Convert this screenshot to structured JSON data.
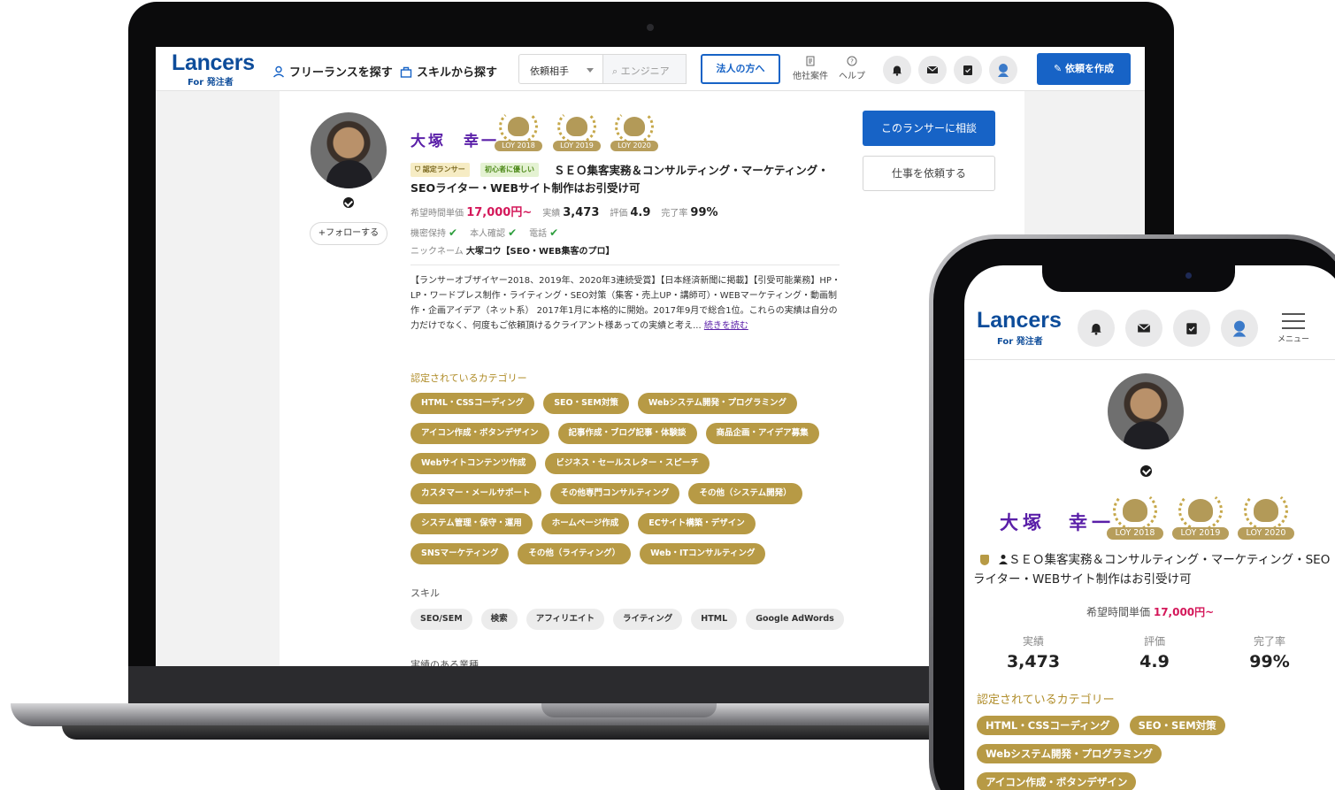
{
  "laptop": {
    "header": {
      "logo": "Lancers",
      "logo_sub": "For 発注者",
      "nav_find": "フリーランスを探す",
      "nav_skill": "スキルから探す",
      "dropdown_value": "依頼相手",
      "search_placeholder": "エンジニア",
      "corp_button": "法人の方へ",
      "link_other": "他社案件",
      "link_help": "ヘルプ",
      "create_button": "依頼を作成"
    },
    "profile": {
      "name": "大塚　幸一",
      "awards": [
        "LOY 2018",
        "LOY 2019",
        "LOY 2020"
      ],
      "badge_certified": "認定ランサー",
      "badge_beginner": "初心者に優しい",
      "tagline": "ＳＥＯ集客実務＆コンサルティング・マーケティング・SEOライター・WEBサイト制作はお引受け可",
      "follow_button": "+フォローする",
      "rate_label": "希望時間単価",
      "rate_value": "17,000円~",
      "achievements_label": "実績",
      "achievements_value": "3,473",
      "rating_label": "評価",
      "rating_value": "4.9",
      "completion_label": "完了率",
      "completion_value": "99%",
      "verify_confidential": "機密保持",
      "verify_identity": "本人確認",
      "verify_phone": "電話",
      "nickname_label": "ニックネーム",
      "nickname_value": "大塚コウ【SEO・WEB集客のプロ】",
      "bio": "【ランサーオブザイヤー2018、2019年、2020年3連続受賞】【日本経済新聞に掲載】【引受可能業務】HP・LP・ワードプレス制作・ライティング・SEO対策（集客・売上UP・講師可）・WEBマーケティング・動画制作・企画アイデア（ネット系） 2017年1月に本格的に開始。2017年9月で総合1位。これらの実績は自分の力だけでなく、何度もご依頼頂けるクライアント様あっての実績と考え... ",
      "bio_more": "続きを読む",
      "consult_button": "このランサーに相談",
      "request_button": "仕事を依頼する"
    },
    "categories_title": "認定されているカテゴリー",
    "categories": [
      [
        "HTML・CSSコーディング",
        "SEO・SEM対策",
        "Webシステム開発・プログラミング"
      ],
      [
        "アイコン作成・ボタンデザイン",
        "記事作成・ブログ記事・体験談",
        "商品企画・アイデア募集"
      ],
      [
        "Webサイトコンテンツ作成",
        "ビジネス・セールスレター・スピーチ"
      ],
      [
        "カスタマー・メールサポート",
        "その他専門コンサルティング",
        "その他（システム開発）"
      ],
      [
        "システム管理・保守・運用",
        "ホームページ作成",
        "ECサイト構築・デザイン"
      ],
      [
        "SNSマーケティング",
        "その他（ライティング）",
        "Web・ITコンサルティング"
      ]
    ],
    "skills_title": "スキル",
    "skills": [
      "SEO/SEM",
      "検索",
      "アフィリエイト",
      "ライティング",
      "HTML",
      "Google AdWords"
    ],
    "industries_title": "実績のある業種"
  },
  "phone": {
    "logo": "Lancers",
    "logo_sub": "For 発注者",
    "menu_label": "メニュー",
    "name": "大塚　幸一",
    "awards": [
      "LOY 2018",
      "LOY 2019",
      "LOY 2020"
    ],
    "tagline": "ＳＥＯ集客実務＆コンサルティング・マーケティング・SEOライター・WEBサイト制作はお引受け可",
    "rate_label": "希望時間単価",
    "rate_value": "17,000円~",
    "stats": [
      {
        "label": "実績",
        "value": "3,473"
      },
      {
        "label": "評価",
        "value": "4.9"
      },
      {
        "label": "完了率",
        "value": "99%"
      }
    ],
    "categories_title": "認定されているカテゴリー",
    "categories": [
      [
        "HTML・CSSコーディング",
        "SEO・SEM対策"
      ],
      [
        "Webシステム開発・プログラミング"
      ],
      [
        "アイコン作成・ボタンデザイン"
      ]
    ]
  },
  "colors": {
    "brand_blue": "#0d4c9a",
    "primary_button": "#1763c6",
    "name_purple": "#5a1fa8",
    "category_gold": "#b79a45",
    "price_pink": "#d4185a"
  }
}
